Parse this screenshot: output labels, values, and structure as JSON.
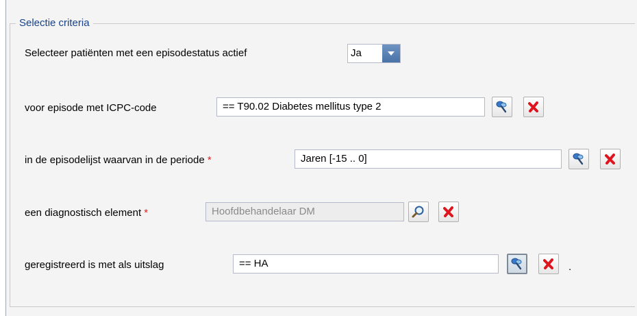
{
  "legend": "Selectie criteria",
  "row1": {
    "label": "Selecteer patiënten met een episodestatus actief",
    "value": "Ja"
  },
  "row2": {
    "label": "voor episode met ICPC-code",
    "value": "== T90.02 Diabetes mellitus type 2"
  },
  "row3": {
    "label": "in de episodelijst waarvan in de periode",
    "required_mark": "*",
    "value": "Jaren [-15 .. 0]"
  },
  "row4": {
    "label": "een diagnostisch element",
    "required_mark": "*",
    "value": "Hoofdbehandelaar DM"
  },
  "row5": {
    "label": "geregistreerd is met als uitslag",
    "value": "== HA",
    "trailing": "."
  },
  "icons": {
    "filter": "filter-pin-icon",
    "search": "magnifier-icon",
    "delete": "red-x-icon",
    "dropdown": "chevron-down-icon"
  },
  "colors": {
    "legend": "#15428b",
    "required": "#e02020",
    "delete": "#e0141e",
    "trigger": "#5b82b5"
  }
}
